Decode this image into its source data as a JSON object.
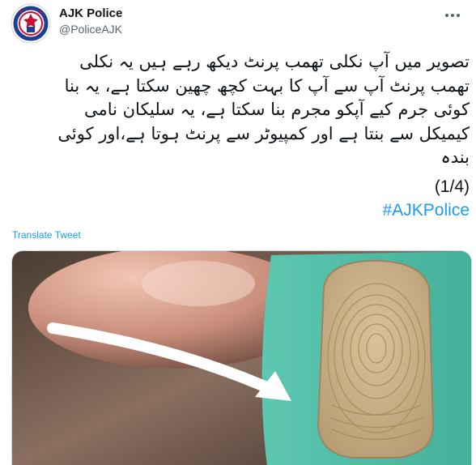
{
  "author": {
    "name": "AJK Police",
    "handle": "@PoliceAJK"
  },
  "tweet": {
    "text": "تصویر میں آپ نکلی تھمب پرنٹ دیکھ رہے ہیں یہ نکلی\nتھمب پرنٹ آپ سے آپ کا بہت کچھ چھین سکتا ہے، یہ بنا\nکوئی جرم کیے آپکو مجرم بنا سکتا ہے، یہ سلیکان نامی\nکیمیکل سے بنتا ہے اور کمپیوٹر سے پرنٹ ہوتا ہے،اور کوئی\nبندہ",
    "counter": "(1/4)",
    "hashtag": "#AJKPolice",
    "translate_label": "Translate Tweet"
  },
  "icons": {
    "more": "more-options-icon",
    "avatar": "police-emblem-logo"
  },
  "colors": {
    "link": "#1d9bf0",
    "handle": "#536471",
    "text": "#0f1419"
  }
}
